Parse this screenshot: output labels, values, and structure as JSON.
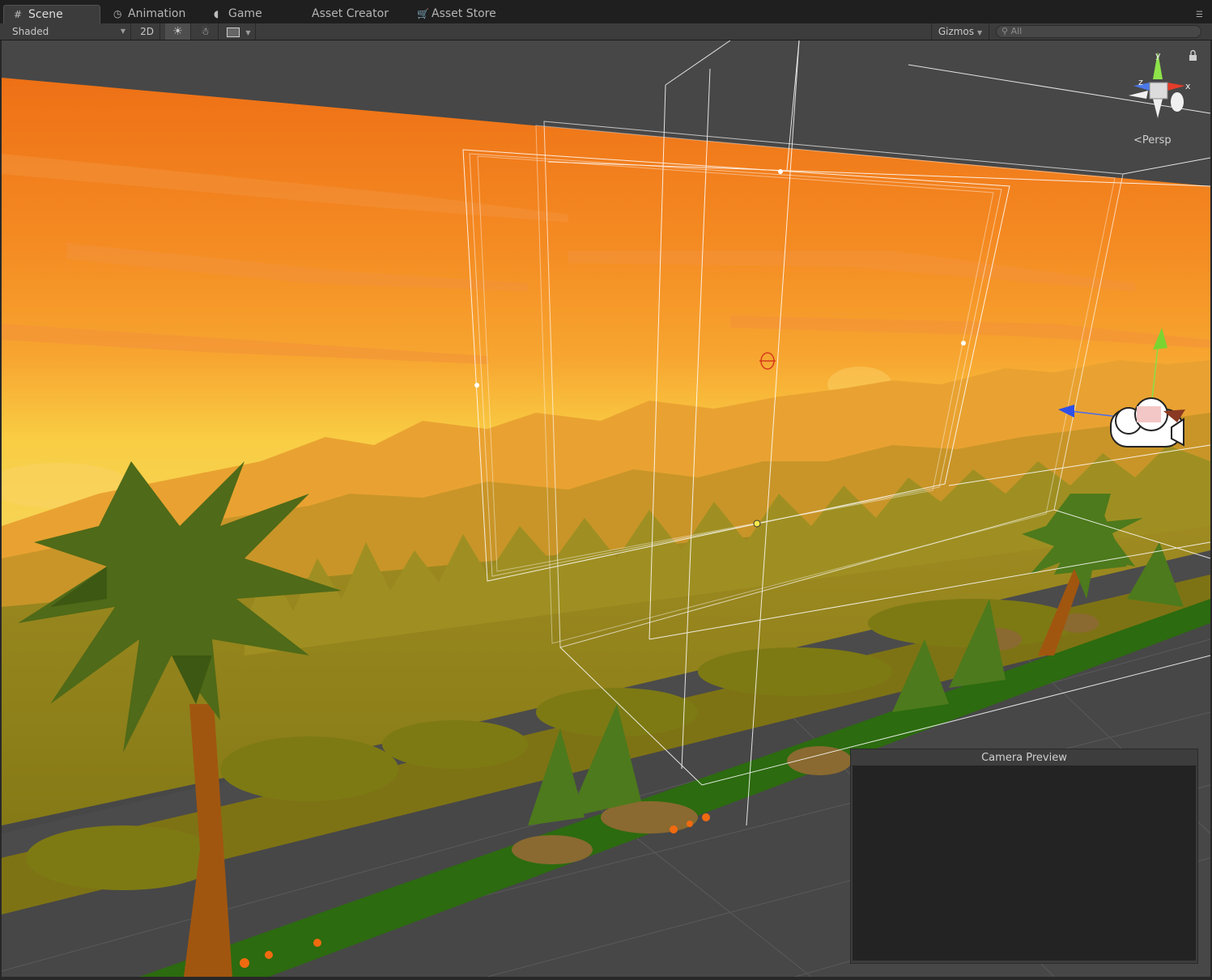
{
  "tabs": [
    {
      "label": "Scene",
      "icon": "scene-grid-icon",
      "active": true
    },
    {
      "label": "Animation",
      "icon": "animation-clock-icon",
      "active": false
    },
    {
      "label": "Game",
      "icon": "game-pacman-icon",
      "active": false
    },
    {
      "label": "Asset Creator",
      "icon": "",
      "active": false
    },
    {
      "label": "Asset Store",
      "icon": "asset-store-bag-icon",
      "active": false
    }
  ],
  "toolbar": {
    "draw_mode": "Shaded",
    "mode_2d": "2D",
    "lighting_icon": "sun-icon",
    "audio_icon": "speaker-icon",
    "effects_icon": "image-effects-icon",
    "gizmos": "Gizmos",
    "search_placeholder": "All"
  },
  "viewport": {
    "projection": "Persp",
    "axis_x": "x",
    "axis_y": "y",
    "axis_z": "z",
    "camera_preview_title": "Camera Preview"
  },
  "colors": {
    "sky_top": "#f07818",
    "sky_mid": "#f79a2c",
    "sky_low": "#f9d34a",
    "ground": "#8a7f18",
    "foliage": "#4f6a18",
    "grass": "#2e6e10",
    "editor_bg": "#282828"
  }
}
